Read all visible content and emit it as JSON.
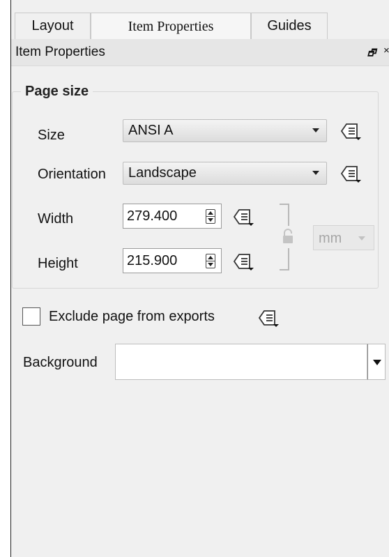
{
  "tabs": [
    {
      "label": "Layout",
      "active": false
    },
    {
      "label": "Item Properties",
      "active": true
    },
    {
      "label": "Guides",
      "active": false
    }
  ],
  "panel": {
    "title": "Item Properties",
    "float_icon": "float-icon",
    "close_icon": "close-icon"
  },
  "page_size": {
    "group_title": "Page size",
    "size_label": "Size",
    "size_value": "ANSI A",
    "orientation_label": "Orientation",
    "orientation_value": "Landscape",
    "width_label": "Width",
    "width_value": "279.400",
    "height_label": "Height",
    "height_value": "215.900",
    "units_value": "mm",
    "units_enabled": false,
    "ratio_locked": false
  },
  "exclude": {
    "label": "Exclude page from exports",
    "checked": false
  },
  "background": {
    "label": "Background",
    "value": ""
  },
  "icons": {
    "data_defined": "data-defined-override-icon",
    "lock": "lock-icon"
  }
}
